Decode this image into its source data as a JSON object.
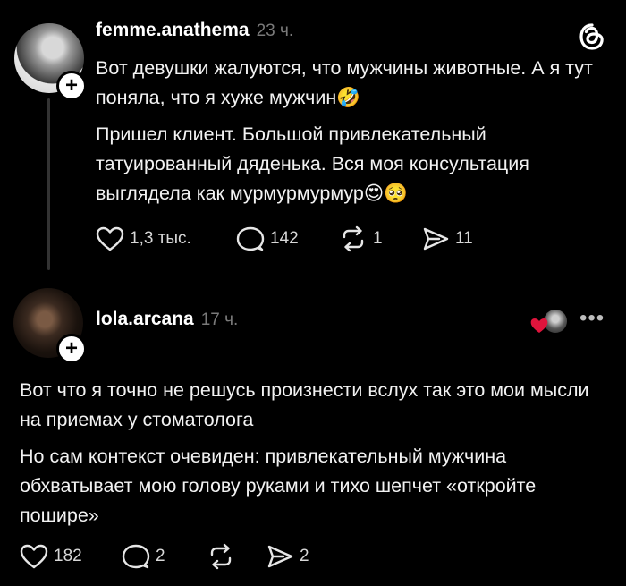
{
  "post1": {
    "username": "femme.anathema",
    "time": "23 ч.",
    "paragraph1": "Вот девушки жалуются, что мужчины животные. А я тут поняла, что я хуже мужчин🤣",
    "paragraph2": "Пришел клиент. Большой привлекательный татуированный дяденька. Вся моя консультация выглядела как мурмурмурмур😍🥺",
    "likes": "1,3 тыс.",
    "comments": "142",
    "reposts": "1",
    "shares": "11"
  },
  "post2": {
    "username": "lola.arcana",
    "time": "17 ч.",
    "paragraph1": "Вот что я точно не решусь произнести вслух так это мои мысли на приемах у стоматолога",
    "paragraph2": "Но сам контекст очевиден: привлекательный мужчина обхватывает мою голову руками и тихо шепчет «откройте пошире»",
    "likes": "182",
    "comments": "2",
    "shares": "2"
  },
  "icons": {
    "follow": "+",
    "more": "•••"
  },
  "colors": {
    "background": "#000000",
    "text": "#f2f2f2",
    "muted": "#7a7a7a",
    "heart": "#e0143c"
  }
}
